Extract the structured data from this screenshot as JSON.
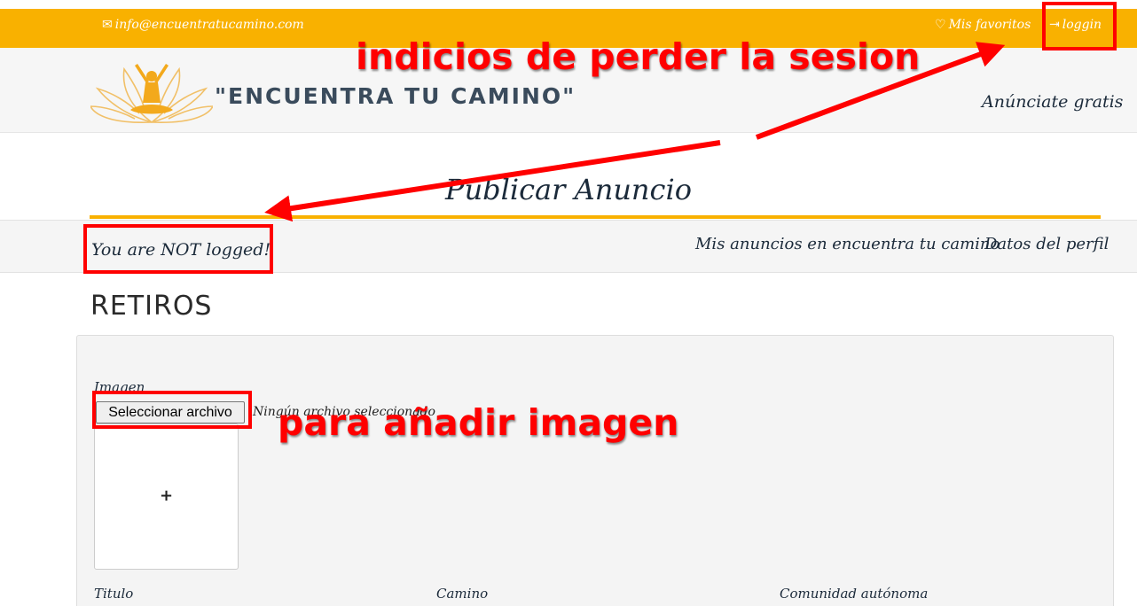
{
  "topbar": {
    "email": "info@encuentratucamino.com",
    "favorites": "Mis favoritos",
    "login": "loggin"
  },
  "header": {
    "brand": "\"ENCUENTRA TU CAMINO\"",
    "advertise": "Anúnciate gratis"
  },
  "page": {
    "title": "Publicar Anuncio",
    "status": "You are NOT logged!",
    "nav": [
      "Mis anuncios en encuentra tu camino",
      "Datos del perfil"
    ],
    "section": "RETIROS"
  },
  "form": {
    "image_label": "Imagen",
    "file_button": "Seleccionar archivo",
    "file_status": "Ningún archivo seleccionado",
    "image_add": "+",
    "fields": [
      "Titulo",
      "Camino",
      "Comunidad autónoma"
    ]
  },
  "annotations": {
    "session": "indicios de perder la sesion",
    "image": "para añadir imagen"
  },
  "colors": {
    "accent": "#f9b100",
    "annotation": "#ff0000",
    "text": "#1b2a3a"
  }
}
